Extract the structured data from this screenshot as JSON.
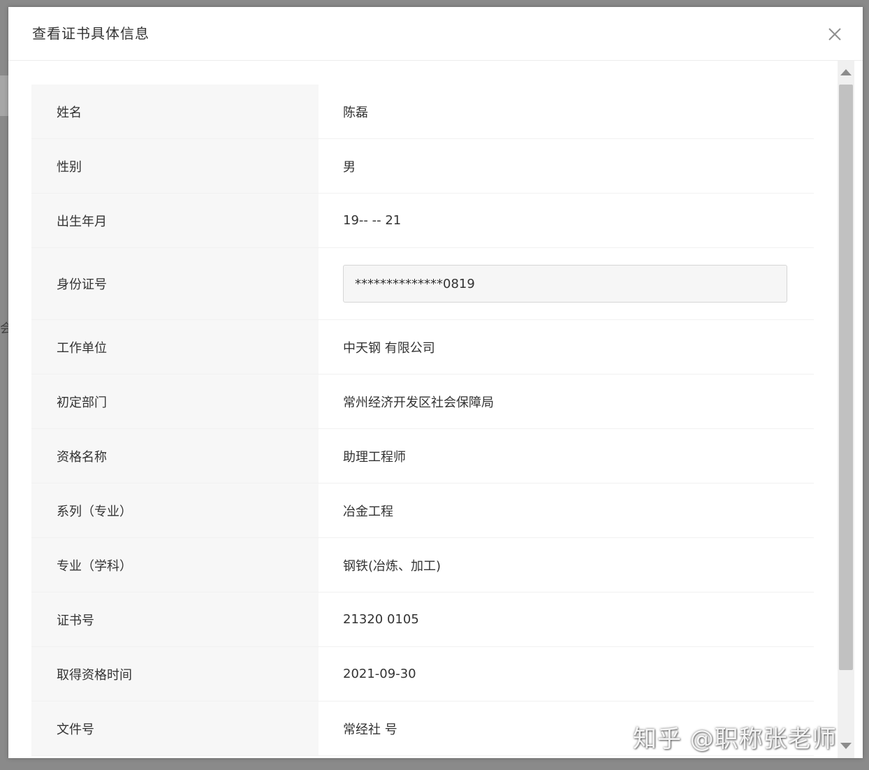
{
  "dialog": {
    "title": "查看证书具体信息"
  },
  "fields": [
    {
      "label": "姓名",
      "value": "陈磊"
    },
    {
      "label": "性别",
      "value": "男"
    },
    {
      "label": "出生年月",
      "value": "19-- -- 21"
    },
    {
      "label": "身份证号",
      "value": "**************0819"
    },
    {
      "label": "工作单位",
      "value": "中天钢      有限公司"
    },
    {
      "label": "初定部门",
      "value": "常州经济开发区社会保障局"
    },
    {
      "label": "资格名称",
      "value": "助理工程师"
    },
    {
      "label": "系列（专业）",
      "value": "冶金工程"
    },
    {
      "label": "专业（学科）",
      "value": "钢铁(冶炼、加工)"
    },
    {
      "label": "证书号",
      "value": "21320          0105"
    },
    {
      "label": "取得资格时间",
      "value": "2021-09-30"
    },
    {
      "label": "文件号",
      "value": "常经社              号"
    }
  ],
  "watermark": "知乎 @职称张老师",
  "icons": {
    "close": "close-icon",
    "scroll_up": "arrow-up-icon",
    "scroll_down": "arrow-down-icon"
  },
  "colors": {
    "label_bg": "#f7f7f7",
    "overlay": "#8a8a8a",
    "input_bg": "#f6f6f6"
  }
}
